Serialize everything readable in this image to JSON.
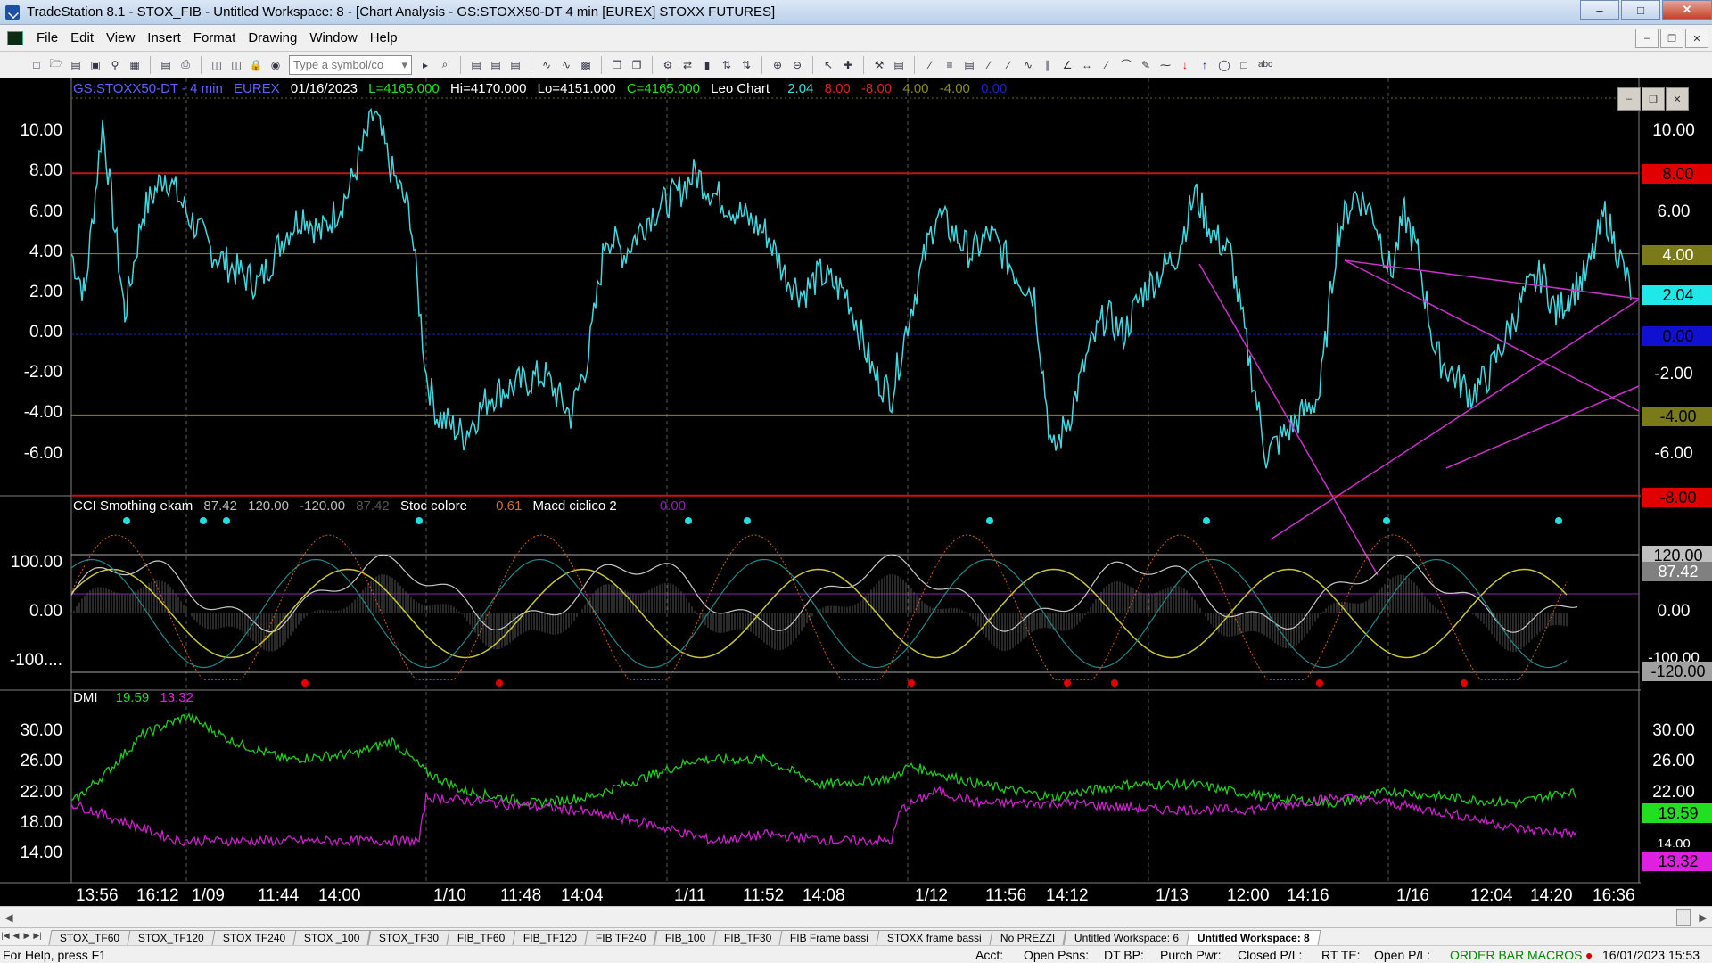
{
  "window": {
    "title": "TradeStation 8.1 - STOX_FIB - Untitled Workspace:  8 - [Chart Analysis - GS:STOXX50-DT  4 min  [EUREX] STOXX FUTURES]",
    "minimize": "–",
    "maximize": "□",
    "close": "✕"
  },
  "menu": [
    "File",
    "Edit",
    "View",
    "Insert",
    "Format",
    "Drawing",
    "Window",
    "Help"
  ],
  "toolbar": {
    "symbol_placeholder": "Type a symbol/co"
  },
  "chart": {
    "header": {
      "symbol": "GS:STOXX50-DT - 4 min",
      "exchange": "EUREX",
      "date": "01/16/2023",
      "last": "L=4165.000",
      "high": "Hi=4170.000",
      "low": "Lo=4151.000",
      "close": "C=4165.000",
      "study": "Leo Chart",
      "v1": "2.04",
      "v2": "8.00",
      "v3": "-8.00",
      "v4": "4.00",
      "v5": "-4.00",
      "v6": "0.00"
    },
    "panel2_header": {
      "study": "CCI Smothing ekam",
      "v1": "87.42",
      "v2": "120.00",
      "v3": "-120.00",
      "v4": "87.42",
      "study2": "Stoc colore",
      "v5": "0.61",
      "study3": "Macd ciclico 2",
      "v6": "0.00"
    },
    "panel3_header": {
      "study": "DMI",
      "v1": "19.59",
      "v2": "13.32"
    },
    "panel1_ylabels": [
      "10.00",
      "8.00",
      "6.00",
      "4.00",
      "2.00",
      "0.00",
      "-2.00",
      "-4.00",
      "-6.00"
    ],
    "panel1_right_labels": [
      "10.00",
      "6.00",
      "-2.00",
      "-6.00"
    ],
    "panel1_right_boxes": [
      "8.00",
      "4.00",
      "2.04",
      "0.00",
      "-4.00",
      "-8.00"
    ],
    "panel2_ylabels": [
      "100.00",
      "0.00",
      "-100...."
    ],
    "panel2_right_labels": [
      "0.00",
      "-100.00"
    ],
    "panel2_right_boxes": [
      "120.00",
      "87.42",
      "-120.00"
    ],
    "panel3_ylabels": [
      "30.00",
      "26.00",
      "22.00",
      "18.00",
      "14.00"
    ],
    "panel3_right_labels": [
      "30.00",
      "26.00",
      "22.00",
      "14.00"
    ],
    "panel3_right_boxes": [
      "19.59",
      "13.32"
    ],
    "xlabels": [
      "13:56",
      "16:12",
      "1/09",
      "11:44",
      "14:00",
      "1/10",
      "11:48",
      "14:04",
      "1/11",
      "11:52",
      "14:08",
      "1/12",
      "11:56",
      "14:12",
      "1/13",
      "12:00",
      "14:16",
      "1/16",
      "12:04",
      "14:20",
      "16:36"
    ],
    "colors": {
      "price_line": "#40d8e0",
      "upper_band": "#cc1010",
      "mid_band": "#8a8a20",
      "zero_line": "#2020c0",
      "trendline": "#cc30cc",
      "dmi_plus": "#20cc20",
      "dmi_minus": "#cc20cc",
      "cci_line": "#c8c8c8",
      "stoc_line": "#c8c830",
      "macd_line": "#208888"
    }
  },
  "tabs": [
    "STOX_TF60",
    "STOX_TF120",
    "STOX TF240",
    "STOX _100",
    "STOX_TF30",
    "FIB_TF60",
    "FIB_TF120",
    "FIB TF240",
    "FIB_100",
    "FIB_TF30",
    "FIB Frame bassi",
    "STOXX frame bassi",
    "No PREZZI",
    "Untitled Workspace:  6",
    "Untitled Workspace:  8"
  ],
  "status": {
    "help": "For Help, press F1",
    "acct": "Acct:",
    "open_psns": "Open Psns:",
    "dt_bp": "DT BP:",
    "purch_pwr": "Purch Pwr:",
    "closed_pl": "Closed P/L:",
    "rt_te": "RT TE:",
    "open_pl": "Open P/L:",
    "order_bar": "ORDER BAR",
    "macros": "MACROS",
    "datetime": "16/01/2023 15:53"
  }
}
